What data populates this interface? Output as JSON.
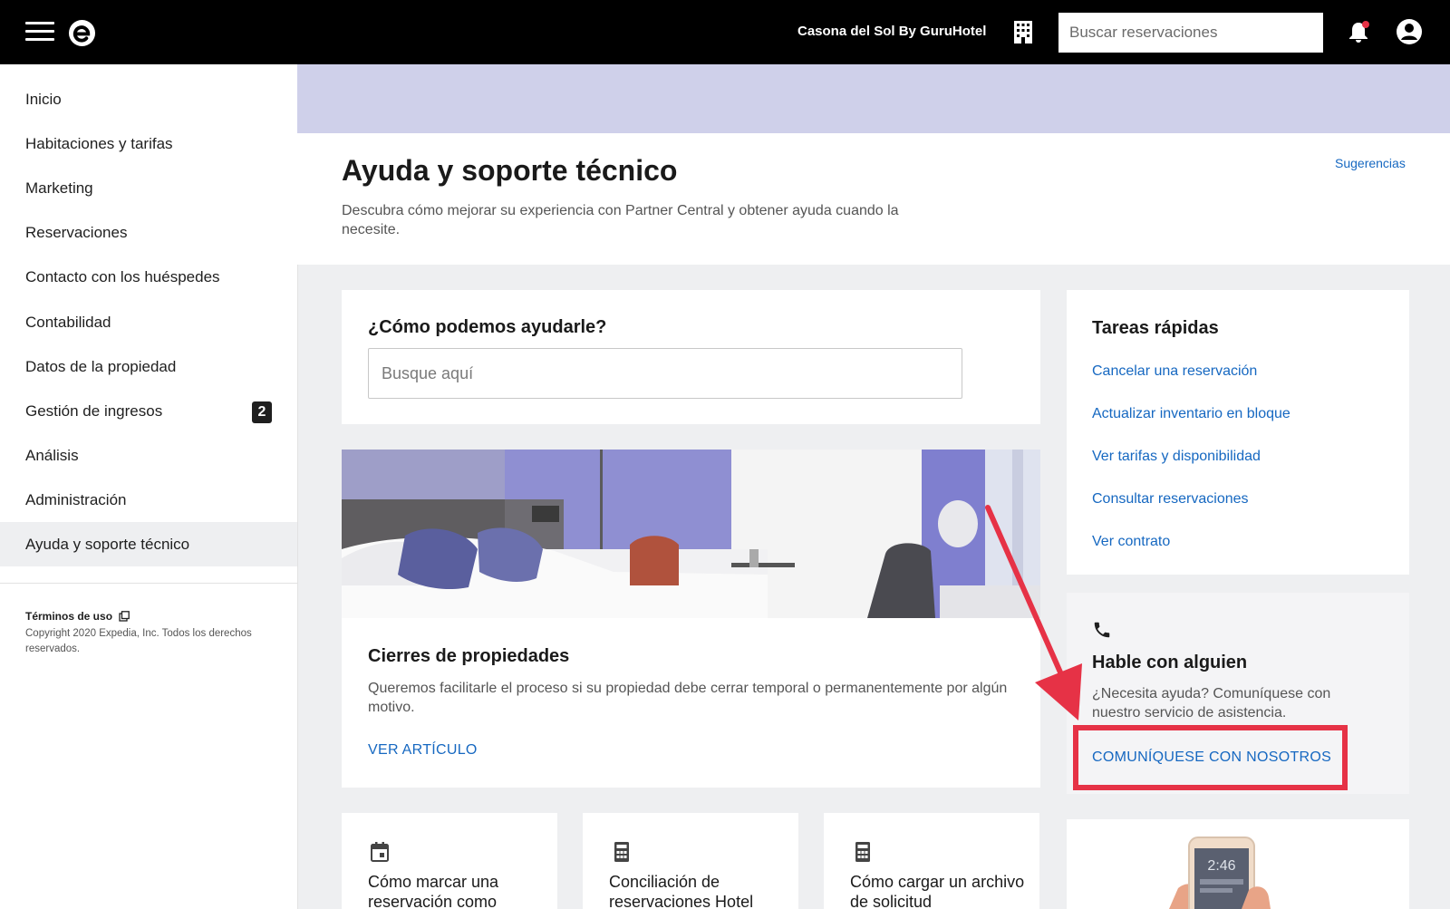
{
  "header": {
    "property_name": "Casona del Sol By GuruHotel",
    "search_placeholder": "Buscar reservaciones"
  },
  "sidebar": {
    "items": [
      {
        "label": "Inicio"
      },
      {
        "label": "Habitaciones y tarifas"
      },
      {
        "label": "Marketing"
      },
      {
        "label": "Reservaciones"
      },
      {
        "label": "Contacto con los huéspedes"
      },
      {
        "label": "Contabilidad"
      },
      {
        "label": "Datos de la propiedad"
      },
      {
        "label": "Gestión de ingresos",
        "badge": "2"
      },
      {
        "label": "Análisis"
      },
      {
        "label": "Administración"
      },
      {
        "label": "Ayuda y soporte técnico",
        "active": true
      }
    ],
    "terms": "Términos de uso",
    "copyright": "Copyright 2020 Expedia, Inc. Todos los derechos reservados."
  },
  "page": {
    "title": "Ayuda y soporte técnico",
    "description": "Descubra cómo mejorar su experiencia con Partner Central y obtener ayuda cuando la necesite.",
    "suggestions": "Sugerencias"
  },
  "help": {
    "title": "¿Cómo podemos ayudarle?",
    "search_placeholder": "Busque aquí"
  },
  "article": {
    "title": "Cierres de propiedades",
    "description": "Queremos facilitarle el proceso si su propiedad debe cerrar temporal o permanentemente por algún motivo.",
    "link": "VER ARTÍCULO"
  },
  "tasks": {
    "title": "Tareas rápidas",
    "links": [
      "Cancelar una reservación",
      "Actualizar inventario en bloque",
      "Ver tarifas y disponibilidad",
      "Consultar reservaciones",
      "Ver contrato"
    ]
  },
  "contact": {
    "title": "Hable con alguien",
    "description": "¿Necesita ayuda? Comuníquese con nuestro servicio de asistencia.",
    "link": "COMUNÍQUESE CON NOSOTROS",
    "highlight_color": "#e63246"
  },
  "small_cards": [
    {
      "title": "Cómo marcar una reservación como",
      "icon": "calendar-icon"
    },
    {
      "title": "Conciliación de reservaciones Hotel",
      "icon": "calculator-icon"
    },
    {
      "title": "Cómo cargar un archivo de solicitud",
      "icon": "calculator-icon"
    }
  ],
  "phone_screen_time": "2:46",
  "colors": {
    "link": "#1668c1",
    "topbar": "#000000",
    "banner": "#cfd0ea",
    "notification_dot": "#e63246"
  }
}
